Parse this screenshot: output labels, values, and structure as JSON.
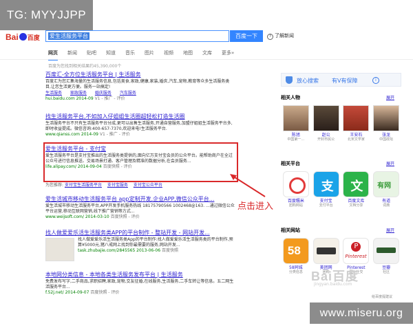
{
  "tag": "TG: MYYJJPP",
  "logo": {
    "left": "Bai",
    "right": "百度"
  },
  "search": {
    "query": "爱生活服务平台",
    "button": "百度一下",
    "help": "了解新闻"
  },
  "tabs": [
    "网页",
    "新闻",
    "贴吧",
    "知道",
    "音乐",
    "图片",
    "视频",
    "地图",
    "文库",
    "更多»"
  ],
  "count": "百度为您找到相关结果约45,390,000个",
  "results": [
    {
      "title": "百度汇-全方位生活服务平台 | 生活服务",
      "desc": "百度汇为您汇集海量的生活服务信息,包括美食,家政,健康,家装,婚庆,汽车,宠物,教育等众多生活服务类目,让您生活更方便。服务一站搞定!",
      "url": "hui.baidu.com 2014-09",
      "ex": "V1 - 推广 - 评价",
      "subs": [
        "生活服务",
        "家政服务",
        "婚庆服务",
        "汽车服务"
      ]
    },
    {
      "title": "找生活服务平台,不如加入仔姐姐生活圈超轻松打造生活圈",
      "desc": "生活服务平台不只有生活服务平台分成,更可以出售生活服务,开通自营服务,加盟仔姐姐生活服务平台多,即时收益提成。微信咨询:400-657-7370,欢迎来电!生活服务平台.",
      "url": "www.qianss.com 2014-09",
      "ex": "V1 - 推广 - 评价",
      "subs": []
    },
    {
      "title": "爱生活服务平台 - 支付宝",
      "desc": "爱生活服务平台是支付宝推出的生活服务类提供的,面向亿万支付宝会员的公众平台。能帮助商户在全过公众号进行信息推送、交易场景打通、客户管理及精准的数据分析,在会员服务...",
      "url": "life.alipay.com/ 2014-09-04",
      "ex": "百度快照 - 评价",
      "subs": []
    },
    {
      "title": "爱生活城市移动生活服务平台 app定制开发,企业APP,微信公众平台...",
      "desc": "爱生活城市移动生活服务平台,APP开发手机服务热线 18175790566 1002468@163. ...通过微信公众平台运营,移动互联网营销,线下推广营销等方式...",
      "url": "www.weijsoft.com/ 2014-03-10",
      "ex": "百度快照 - 评价",
      "subs": []
    },
    {
      "title": "找人做爱爱乐活生活服务类APP的平台制作 - 整站开发 - 网站开发...",
      "desc": "找人做爱爱乐活生活服务类App的平台制作:找人做爱爱乐活生活服务类的平台制作,预算¥5000元,猪八戒网上找到你最需要的服务,网站开发...",
      "url": "task.zhubajie.com/2845565 2013-06-06",
      "ex": "百度快照",
      "subs": []
    },
    {
      "title": "本地网分类信息 - 本地各类生活服务发布平台 | 生活服务",
      "desc": "免费发布写字,二手商品,求职招聘,家政,宠物,交友征婚,在线服务,生活服务,二手车转让等信息。五二网生活服务平台...",
      "url": "f.52j.net/ 2014-09-07",
      "ex": "百度快照 - 评价",
      "subs": []
    }
  ],
  "related": {
    "label": "为您推荐:",
    "items": [
      "支付宝生活服务平台",
      "支付宝服务",
      "支付宝公众平台"
    ]
  },
  "annotation": "点击进入",
  "right": {
    "secure": {
      "label": "放心搜索",
      "badge": "有V有保障",
      "mark": "i"
    },
    "people": {
      "title": "相关人物",
      "more": "展开",
      "items": [
        {
          "name": "陈旭",
          "sub": "中国第一…"
        },
        {
          "name": "赵公",
          "sub": "开封市民公"
        },
        {
          "name": "王安石",
          "sub": "北宋文学家"
        },
        {
          "name": "张龙",
          "sub": "中国政坛"
        }
      ]
    },
    "platform": {
      "title": "相关平台",
      "more": "展开",
      "items": [
        {
          "name": "百度糯米",
          "sub": "团购网站"
        },
        {
          "name": "支付宝",
          "sub": "支付平台"
        },
        {
          "name": "百度文库",
          "sub": "文档分享"
        },
        {
          "name": "有道",
          "sub": "词典"
        }
      ]
    },
    "sites": {
      "title": "相关网站",
      "more": "展开",
      "items": [
        {
          "name": "58同城",
          "sub": "分类信息"
        },
        {
          "name": "美团网",
          "sub": "团购"
        },
        {
          "name": "Pinterest",
          "sub": "图片社交"
        },
        {
          "name": "豆瓣",
          "sub": "社区"
        }
      ]
    }
  },
  "baidu_mark": "Bai百度",
  "baidu_sub": "jingyan.baidu.com",
  "site_tag": "www.miseru.org",
  "footer": "给百度提建议"
}
